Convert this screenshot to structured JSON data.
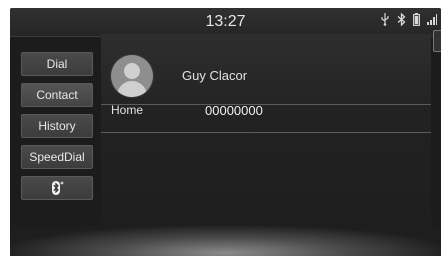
{
  "status": {
    "time": "13:27",
    "icons": [
      "usb-icon",
      "bluetooth-icon",
      "battery-icon",
      "signal-icon"
    ]
  },
  "menu": {
    "items": [
      {
        "label": "Dial"
      },
      {
        "label": "Contact"
      },
      {
        "label": "History"
      },
      {
        "label": "SpeedDial"
      },
      {
        "label": "",
        "icon": "bluetooth-settings-icon"
      }
    ]
  },
  "contact": {
    "name": "Guy Clacor",
    "phone_type": "Home",
    "phone_number": "00000000"
  }
}
